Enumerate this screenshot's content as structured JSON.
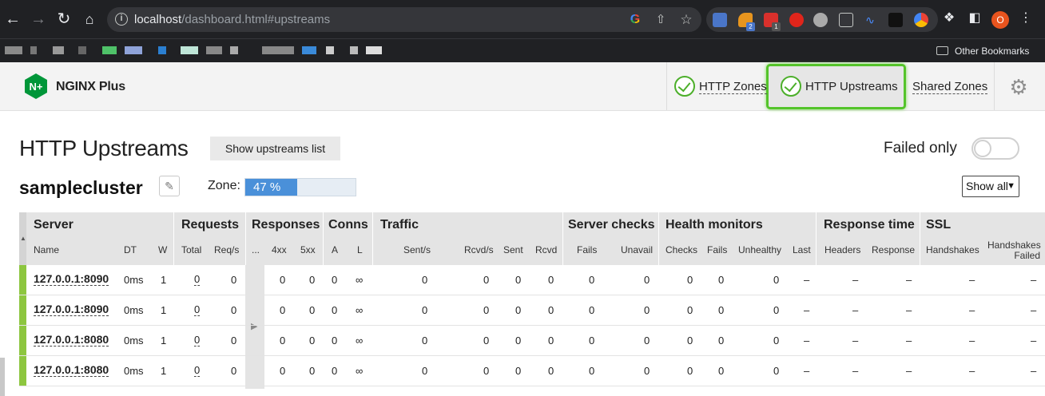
{
  "browser": {
    "url_host": "localhost",
    "url_path": "/dashboard.html#upstreams",
    "ext_badge_1": "2",
    "ext_badge_2": "1",
    "avatar_letter": "O",
    "other_bookmarks": "Other Bookmarks"
  },
  "app": {
    "brand": "NGINX Plus",
    "logo_mark": "N+",
    "tabs": [
      {
        "label": "HTTP Zones"
      },
      {
        "label": "HTTP Upstreams"
      },
      {
        "label": "Shared Zones"
      }
    ]
  },
  "page": {
    "title": "HTTP Upstreams",
    "show_list_label": "Show upstreams list",
    "failed_only_label": "Failed only"
  },
  "upstream": {
    "name": "samplecluster",
    "zone_label": "Zone:",
    "zone_percent": 47,
    "zone_text": "47 %",
    "show_filter": "Show all"
  },
  "table": {
    "groups": {
      "server": "Server",
      "requests": "Requests",
      "responses": "Responses",
      "conns": "Conns",
      "traffic": "Traffic",
      "server_checks": "Server checks",
      "health_monitors": "Health monitors",
      "response_time": "Response time",
      "ssl": "SSL"
    },
    "columns": {
      "name": "Name",
      "dt": "DT",
      "w": "W",
      "total": "Total",
      "reqs": "Req/s",
      "more": "...",
      "r4xx": "4xx",
      "r5xx": "5xx",
      "a": "A",
      "l": "L",
      "sent_s": "Sent/s",
      "rcvd_s": "Rcvd/s",
      "sent": "Sent",
      "rcvd": "Rcvd",
      "fails": "Fails",
      "unavail": "Unavail",
      "checks": "Checks",
      "hm_fails": "Fails",
      "unhealthy": "Unhealthy",
      "last": "Last",
      "headers": "Headers",
      "response": "Response",
      "handshakes": "Handshakes",
      "hs_failed_1": "Handshakes",
      "hs_failed_2": "Failed"
    },
    "rows": [
      {
        "name": "127.0.0.1:8090",
        "dt": "0ms",
        "w": "1",
        "total": "0",
        "reqs": "0",
        "r4xx": "0",
        "r5xx": "0",
        "a": "0",
        "l": "∞",
        "sent_s": "0",
        "rcvd_s": "0",
        "sent": "0",
        "rcvd": "0",
        "fails": "0",
        "unavail": "0",
        "checks": "0",
        "hm_fails": "0",
        "unhealthy": "0",
        "last": "–",
        "headers": "–",
        "response": "–",
        "handshakes": "–",
        "hs_failed": "–"
      },
      {
        "name": "127.0.0.1:8090",
        "dt": "0ms",
        "w": "1",
        "total": "0",
        "reqs": "0",
        "r4xx": "0",
        "r5xx": "0",
        "a": "0",
        "l": "∞",
        "sent_s": "0",
        "rcvd_s": "0",
        "sent": "0",
        "rcvd": "0",
        "fails": "0",
        "unavail": "0",
        "checks": "0",
        "hm_fails": "0",
        "unhealthy": "0",
        "last": "–",
        "headers": "–",
        "response": "–",
        "handshakes": "–",
        "hs_failed": "–"
      },
      {
        "name": "127.0.0.1:8080",
        "dt": "0ms",
        "w": "1",
        "total": "0",
        "reqs": "0",
        "r4xx": "0",
        "r5xx": "0",
        "a": "0",
        "l": "∞",
        "sent_s": "0",
        "rcvd_s": "0",
        "sent": "0",
        "rcvd": "0",
        "fails": "0",
        "unavail": "0",
        "checks": "0",
        "hm_fails": "0",
        "unhealthy": "0",
        "last": "–",
        "headers": "–",
        "response": "–",
        "handshakes": "–",
        "hs_failed": "–"
      },
      {
        "name": "127.0.0.1:8080",
        "dt": "0ms",
        "w": "1",
        "total": "0",
        "reqs": "0",
        "r4xx": "0",
        "r5xx": "0",
        "a": "0",
        "l": "∞",
        "sent_s": "0",
        "rcvd_s": "0",
        "sent": "0",
        "rcvd": "0",
        "fails": "0",
        "unavail": "0",
        "checks": "0",
        "hm_fails": "0",
        "unhealthy": "0",
        "last": "–",
        "headers": "–",
        "response": "–",
        "handshakes": "–",
        "hs_failed": "–"
      }
    ]
  },
  "colors": {
    "accent_green": "#54c42a",
    "status_up": "#8dc63f",
    "zone_fill": "#4a90d9",
    "brand_green": "#009639"
  }
}
